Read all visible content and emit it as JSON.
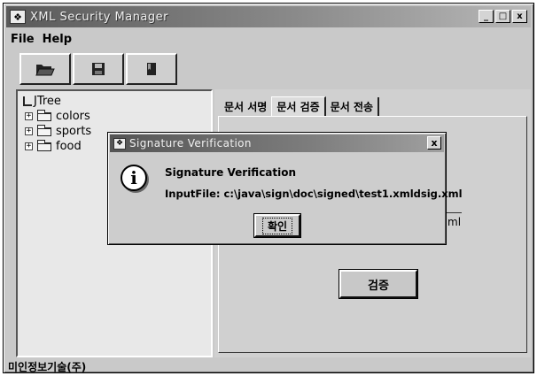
{
  "window": {
    "title": "XML Security Manager",
    "minimize_glyph": "_",
    "maximize_glyph": "□",
    "close_glyph": "x"
  },
  "menu": {
    "items": [
      "File",
      "Help"
    ]
  },
  "toolbar": {
    "buttons": [
      "open-icon",
      "save-icon",
      "book-icon"
    ]
  },
  "tree": {
    "root": "JTree",
    "expander_glyph": "+",
    "nodes": [
      "colors",
      "sports",
      "food"
    ]
  },
  "tabs": {
    "items": [
      "문서 서명",
      "문서 검증",
      "문서 전송"
    ],
    "active_index": 1
  },
  "panel": {
    "file_suffix": "ml",
    "verify_label": "검증"
  },
  "dialog": {
    "title": "Signature Verification",
    "close_glyph": "x",
    "icon_glyph": "i",
    "message": "Signature Verification",
    "detail": "InputFile: c:\\java\\sign\\doc\\signed\\test1.xmldsig.xml",
    "ok_label": "확인"
  },
  "status": {
    "text": "미인정보기술(주)"
  },
  "colors": {
    "titlebar": "#5a5a5a",
    "window_bg": "#c9c9c9"
  }
}
